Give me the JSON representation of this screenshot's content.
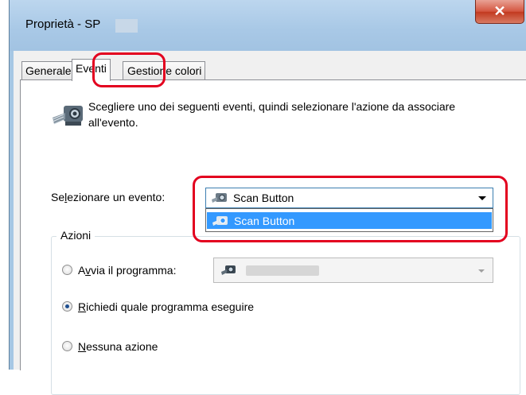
{
  "window": {
    "title": "Proprietà - SP",
    "close_glyph": "✕"
  },
  "tabs": [
    {
      "label": "Generale",
      "active": false
    },
    {
      "label": "Eventi",
      "active": true
    },
    {
      "label": "Gestione colori",
      "active": false
    }
  ],
  "description": "Scegliere uno dei seguenti eventi, quindi selezionare l'azione da associare all'evento.",
  "event": {
    "label_before": "Se",
    "label_u": "l",
    "label_after": "ezionare un evento:",
    "selected": "Scan Button",
    "options": [
      "Scan Button"
    ]
  },
  "actions": {
    "group_label": "Azioni",
    "start_program": {
      "before": "A",
      "u": "v",
      "after": "via il programma:",
      "checked": false
    },
    "ask_program": {
      "before": "",
      "u": "R",
      "after": "ichiedi quale programma eseguire",
      "checked": true
    },
    "no_action": {
      "before": "",
      "u": "N",
      "after": "essuna azione",
      "checked": false
    }
  },
  "colors": {
    "highlight": "#e3001f",
    "selection": "#3399ff"
  },
  "icons": {
    "scanner": "scanner-icon",
    "scan_button": "scan-button-icon",
    "program": "program-icon"
  }
}
